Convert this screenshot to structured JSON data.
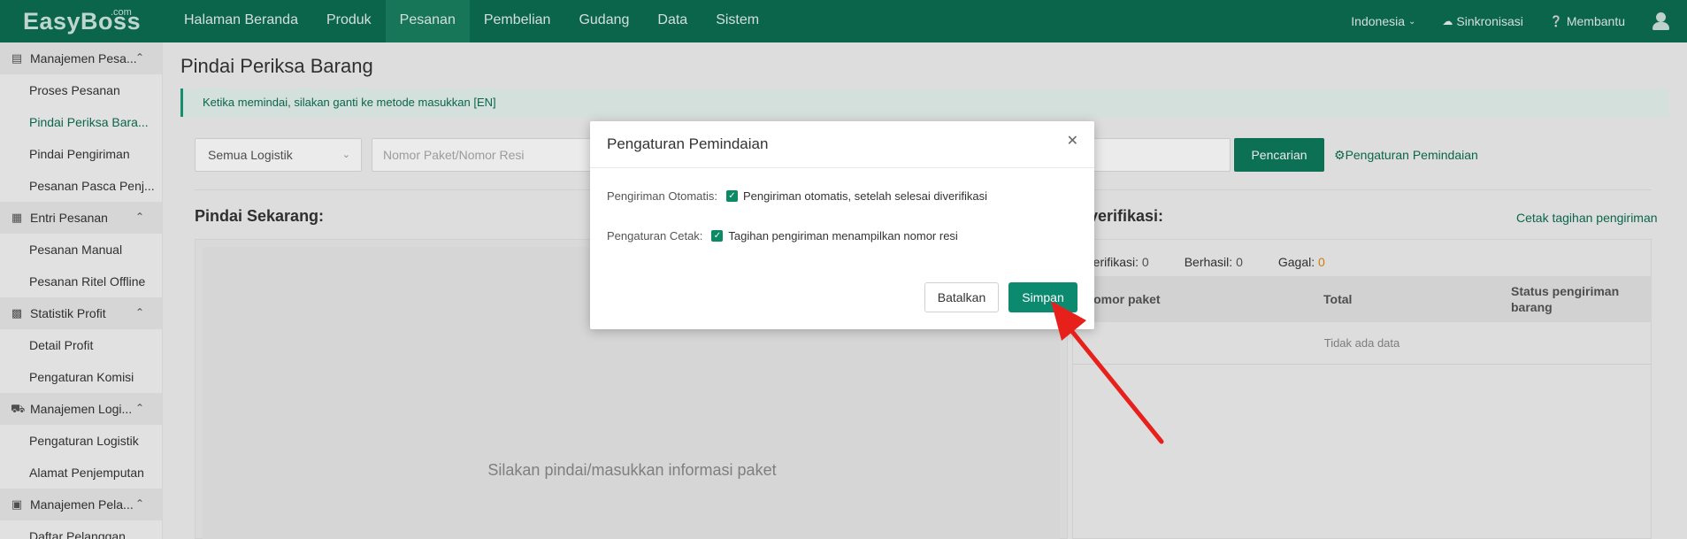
{
  "header": {
    "logo": "EasyBoss",
    "logo_sup": ".com",
    "nav": [
      "Halaman Beranda",
      "Produk",
      "Pesanan",
      "Pembelian",
      "Gudang",
      "Data",
      "Sistem"
    ],
    "active_nav": "Pesanan",
    "language": "Indonesia",
    "sync": "Sinkronisasi",
    "help": "Membantu"
  },
  "sidebar": {
    "groups": [
      {
        "label": "Manajemen Pesa...",
        "icon": "clipboard-icon",
        "items": [
          "Proses Pesanan",
          "Pindai Periksa Bara...",
          "Pindai Pengiriman",
          "Pesanan Pasca Penj..."
        ]
      },
      {
        "label": "Entri Pesanan",
        "icon": "entry-icon",
        "items": [
          "Pesanan Manual",
          "Pesanan Ritel Offline"
        ]
      },
      {
        "label": "Statistik Profit",
        "icon": "stats-icon",
        "items": [
          "Detail Profit",
          "Pengaturan Komisi"
        ]
      },
      {
        "label": "Manajemen Logi...",
        "icon": "truck-icon",
        "items": [
          "Pengaturan Logistik",
          "Alamat Penjemputan"
        ]
      },
      {
        "label": "Manajemen Pela...",
        "icon": "customer-icon",
        "items": [
          "Daftar Pelanggan"
        ]
      }
    ],
    "active_item": "Pindai Periksa Bara..."
  },
  "main": {
    "title": "Pindai Periksa Barang",
    "notice": "Ketika memindai, silakan ganti ke metode masukkan [EN]",
    "logistics_select": "Semua Logistik",
    "search_placeholder": "Nomor Paket/Nomor Resi",
    "search_button": "Pencarian",
    "scan_settings_link": "Pengaturan Pemindaian",
    "scan_now": "Pindai Sekarang:",
    "scan_hint": "Silakan pindai/masukkan informasi paket",
    "verified_title": "rverifikasi:",
    "print_link": "Cetak tagihan pengiriman",
    "stats": {
      "verified_label": "rverifikasi:",
      "verified_value": "0",
      "success_label": "Berhasil:",
      "success_value": "0",
      "fail_label": "Gagal:",
      "fail_value": "0"
    },
    "table": {
      "headers": [
        "Nomor paket",
        "Total",
        "Status pengiriman barang"
      ],
      "empty": "Tidak ada data"
    }
  },
  "modal": {
    "title": "Pengaturan Pemindaian",
    "rows": [
      {
        "label": "Pengiriman Otomatis:",
        "checkbox_text": "Pengiriman otomatis, setelah selesai diverifikasi",
        "checked": true
      },
      {
        "label": "Pengaturan Cetak:",
        "checkbox_text": "Tagihan pengiriman menampilkan nomor resi",
        "checked": true
      }
    ],
    "cancel": "Batalkan",
    "save": "Simpan"
  },
  "colors": {
    "brand": "#0c6e52",
    "accent_button": "#0c8a70",
    "annotation_arrow": "#e8201c"
  }
}
